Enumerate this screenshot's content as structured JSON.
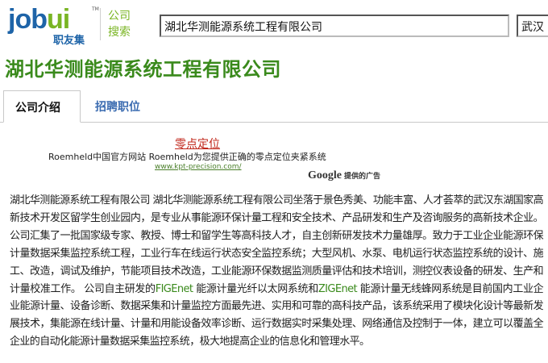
{
  "header": {
    "logo_text": "jobui",
    "logo_tm": "TM",
    "logo_subtitle": "职友集",
    "section_label_1": "公司",
    "section_label_2": "搜索",
    "search_value": "湖北华测能源系统工程有限公司",
    "city_value": "武汉"
  },
  "company": {
    "title": "湖北华测能源系统工程有限公司"
  },
  "tabs": [
    {
      "label": "公司介绍",
      "active": true
    },
    {
      "label": "招聘职位",
      "active": false
    }
  ],
  "ad": {
    "title": "零点定位",
    "text": "Roemheld中国官方网站 Roemheld为您提供正确的零点定位夹紧系统",
    "url": "www.kpt-precision.com/",
    "google_label": "Google",
    "provided_label": "提供的广告"
  },
  "description": {
    "part1": "湖北华测能源系统工程有限公司 湖北华测能源系统工程有限公司坐落于景色秀美、功能丰富、人才荟萃的武汉东湖国家高新技术开发区留学生创业园内，是专业从事能源环保计量工程和安全技术、产品研发和生产及咨询服务的高新技术企业。 公司汇集了一批国家级专家、教授、博士和留学生等高科技人才，自主创新研发技术力量雄厚。致力于工业企业能源环保计量数据采集监控系统工程，工业行车在线运行状态安全监控系统；大型风机、水泵、电机运行状态监控系统的设计、施工、改造，调试及维护，节能项目技术改造，工业能源环保数据监测质量评估和技术培训，测控仪表设备的研发、生产和计量校准工作。 公司自主研发的",
    "link1": "FIGEnet",
    "part2": " 能源计量光纤以太网系统和",
    "link2": "ZIGEnet",
    "part3": " 能源计量无线蜂网系统是目前国内工业企业能源计量、设备诊断、数据采集和计量监控方面最先进、实用和可靠的高科技产品，该系统采用了模块化设计等最新发展技术，集能源在线计量、计量和用能设备效率诊断、运行数据实时采集处理、网络通信及控制于一体，建立可以覆盖全企业的自动化能源计量数据采集监控系统，极大地提高企业的信息化和管理水平。"
  },
  "colors": {
    "brand_blue": "#1e64a8",
    "brand_green": "#7ab524",
    "title_green": "#3a8a1c",
    "link_blue": "#3a6bb0",
    "ad_red": "#c0261a"
  }
}
